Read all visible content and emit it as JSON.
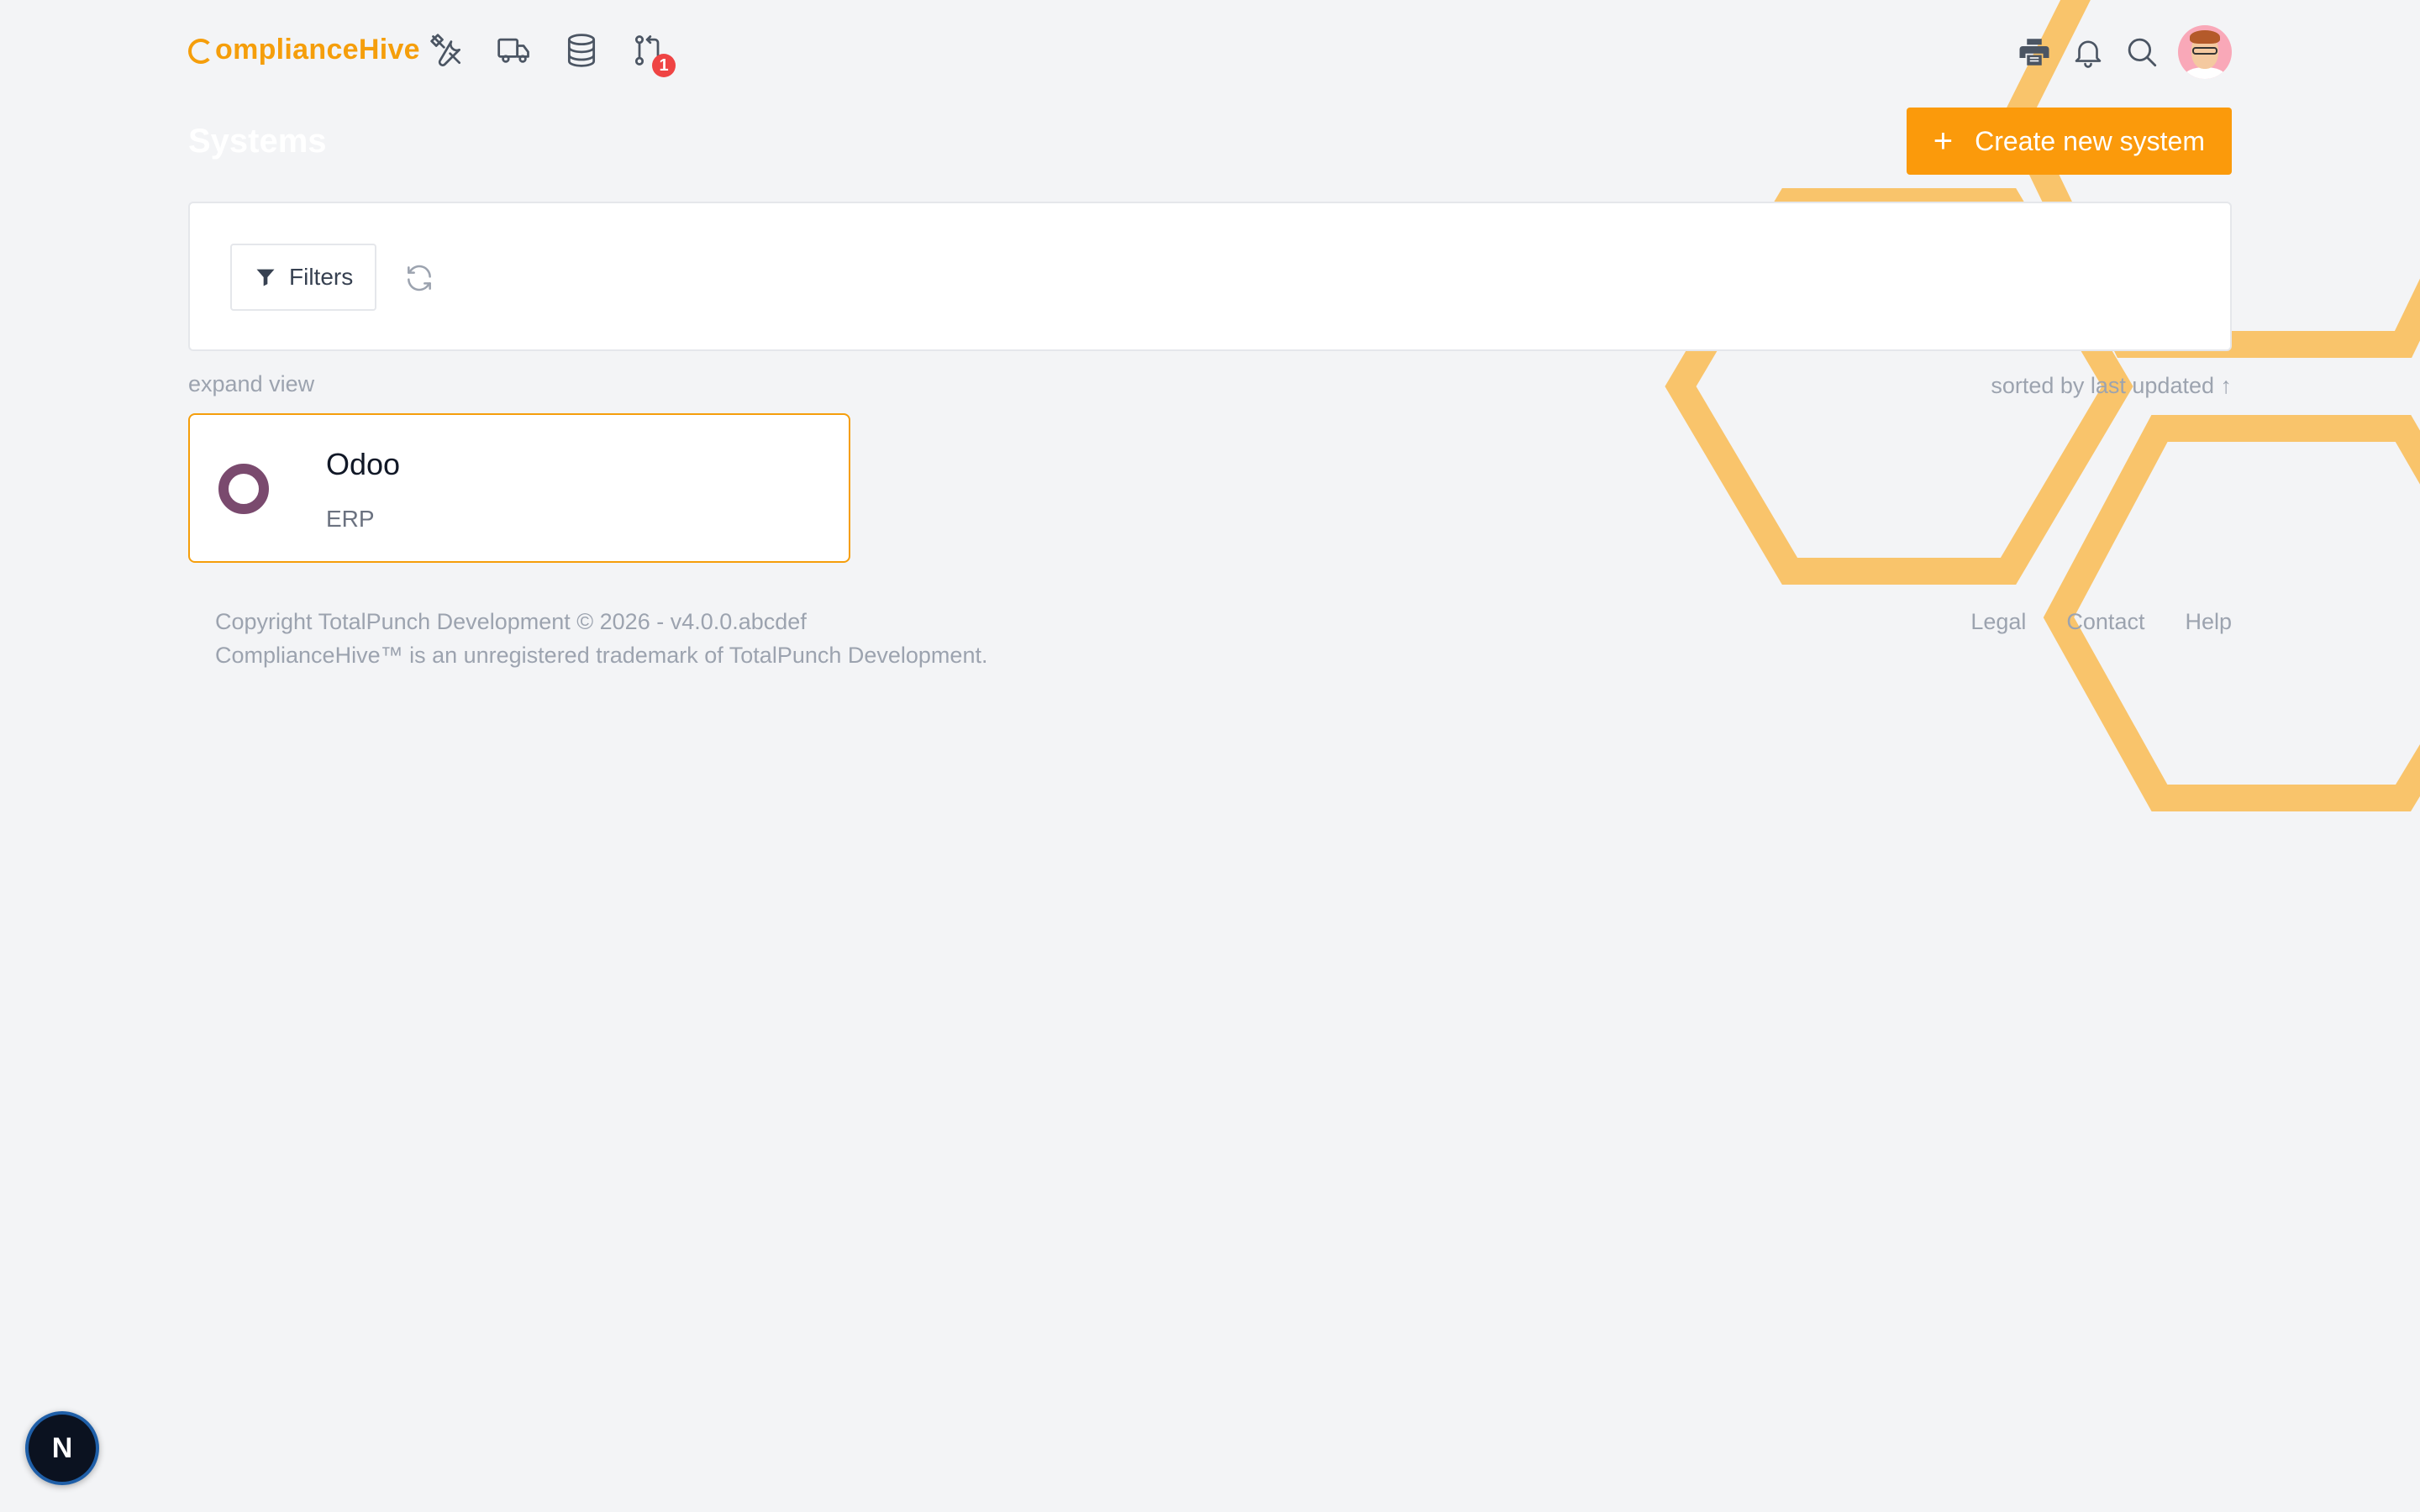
{
  "app": {
    "logo_text": "omplianceHive",
    "logo_letter": "C",
    "brand_color": "#f59e0b",
    "accent_color": "#fb9a0b"
  },
  "nav": {
    "icons": [
      "tools-icon",
      "truck-icon",
      "database-icon",
      "git-pull-request-icon"
    ],
    "badge_count": "1",
    "right_icons": [
      "printer-icon",
      "bell-icon",
      "search-icon",
      "avatar"
    ]
  },
  "header": {
    "title": "Systems",
    "create_label": "Create new system"
  },
  "filters": {
    "filters_label": "Filters"
  },
  "list_meta": {
    "expand_label": "expand view",
    "sort_label": "sorted by last updated ↑"
  },
  "systems": [
    {
      "name": "Odoo",
      "type": "ERP"
    }
  ],
  "footer": {
    "copyright_line1": "Copyright TotalPunch Development © 2026 - v4.0.0.abcdef",
    "copyright_line2": "ComplianceHive™ is an unregistered trademark of TotalPunch Development.",
    "links": [
      "Legal",
      "Contact",
      "Help"
    ]
  },
  "dev_indicator": {
    "letter": "N"
  }
}
